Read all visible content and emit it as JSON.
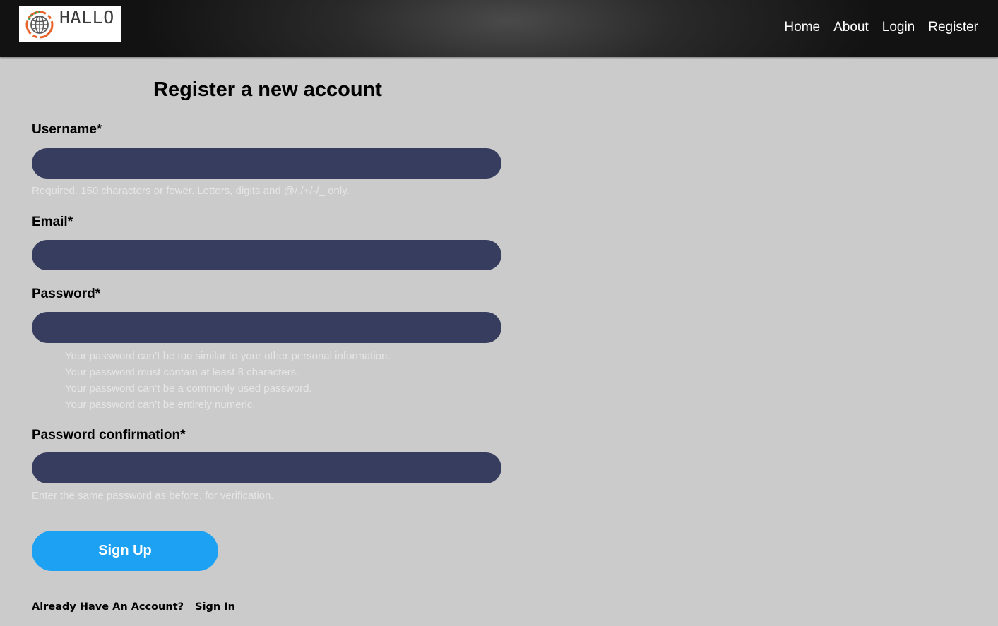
{
  "brand": {
    "name": "HALLO",
    "icon": "globe-icon",
    "colors": {
      "ring_orange": "#e8632a",
      "ring_green": "#3aa35a",
      "globe_gray": "#5a5a5a"
    }
  },
  "nav": {
    "items": [
      {
        "label": "Home"
      },
      {
        "label": "About"
      },
      {
        "label": "Login"
      },
      {
        "label": "Register"
      }
    ]
  },
  "page": {
    "title": "Register a new account"
  },
  "form": {
    "username": {
      "label": "Username*",
      "value": "",
      "help": "Required. 150 characters or fewer. Letters, digits and @/./+/-/_ only."
    },
    "email": {
      "label": "Email*",
      "value": ""
    },
    "password": {
      "label": "Password*",
      "value": "",
      "help": [
        "Your password can’t be too similar to your other personal information.",
        "Your password must contain at least 8 characters.",
        "Your password can’t be a commonly used password.",
        "Your password can’t be entirely numeric."
      ]
    },
    "password_confirmation": {
      "label": "Password confirmation*",
      "value": "",
      "help": "Enter the same password as before, for verification."
    },
    "submit_label": "Sign Up"
  },
  "footer": {
    "prompt": "Already Have An Account?",
    "link_label": "Sign In"
  },
  "theme": {
    "background": "#cbcbcb",
    "input_bg": "#363d5e",
    "button_bg": "#1da1f2",
    "help_text": "#e6e6e6"
  }
}
